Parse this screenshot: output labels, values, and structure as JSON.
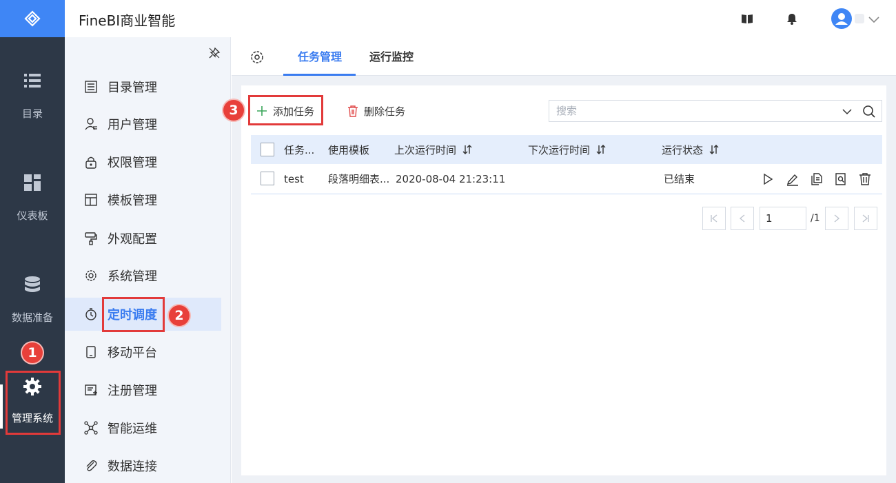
{
  "app": {
    "title": "FineBI商业智能"
  },
  "rail": {
    "items": [
      {
        "label": "目录",
        "icon": "list-icon"
      },
      {
        "label": "仪表板",
        "icon": "dashboard-icon"
      },
      {
        "label": "数据准备",
        "icon": "database-icon"
      },
      {
        "label": "管理系统",
        "icon": "gear-icon",
        "active": true
      }
    ]
  },
  "header": {
    "icons": [
      "book-icon",
      "bell-icon",
      "user-avatar-icon",
      "chevron-down-icon"
    ]
  },
  "menu": {
    "items": [
      {
        "label": "目录管理",
        "icon": "catalog-icon"
      },
      {
        "label": "用户管理",
        "icon": "user-icon"
      },
      {
        "label": "权限管理",
        "icon": "lock-icon"
      },
      {
        "label": "模板管理",
        "icon": "template-icon"
      },
      {
        "label": "外观配置",
        "icon": "paint-roller-icon"
      },
      {
        "label": "系统管理",
        "icon": "settings-icon"
      },
      {
        "label": "定时调度",
        "icon": "timer-icon",
        "active": true
      },
      {
        "label": "移动平台",
        "icon": "mobile-icon"
      },
      {
        "label": "注册管理",
        "icon": "register-icon"
      },
      {
        "label": "智能运维",
        "icon": "network-icon"
      },
      {
        "label": "数据连接",
        "icon": "paperclip-icon"
      }
    ]
  },
  "tabs": [
    {
      "label": "任务管理",
      "active": true
    },
    {
      "label": "运行监控",
      "active": false
    }
  ],
  "toolbar": {
    "add_label": "添加任务",
    "delete_label": "删除任务",
    "search_placeholder": "搜索"
  },
  "table": {
    "columns": [
      "任务...",
      "使用模板",
      "上次运行时间",
      "下次运行时间",
      "运行状态"
    ],
    "rows": [
      {
        "name": "test",
        "template": "段落明细表...",
        "last_run": "2020-08-04 21:23:11",
        "next_run": "",
        "status": "已结束"
      }
    ],
    "row_actions": [
      "play-icon",
      "edit-icon",
      "copy-icon",
      "view-log-icon",
      "trash-icon"
    ]
  },
  "pager": {
    "current": "1",
    "total": "/1"
  },
  "annotations": {
    "badge1": "1",
    "badge2": "2",
    "badge3": "3"
  },
  "colors": {
    "accent": "#3a7cf0",
    "rail_bg": "#2d3847",
    "highlight": "#e23a3a"
  }
}
